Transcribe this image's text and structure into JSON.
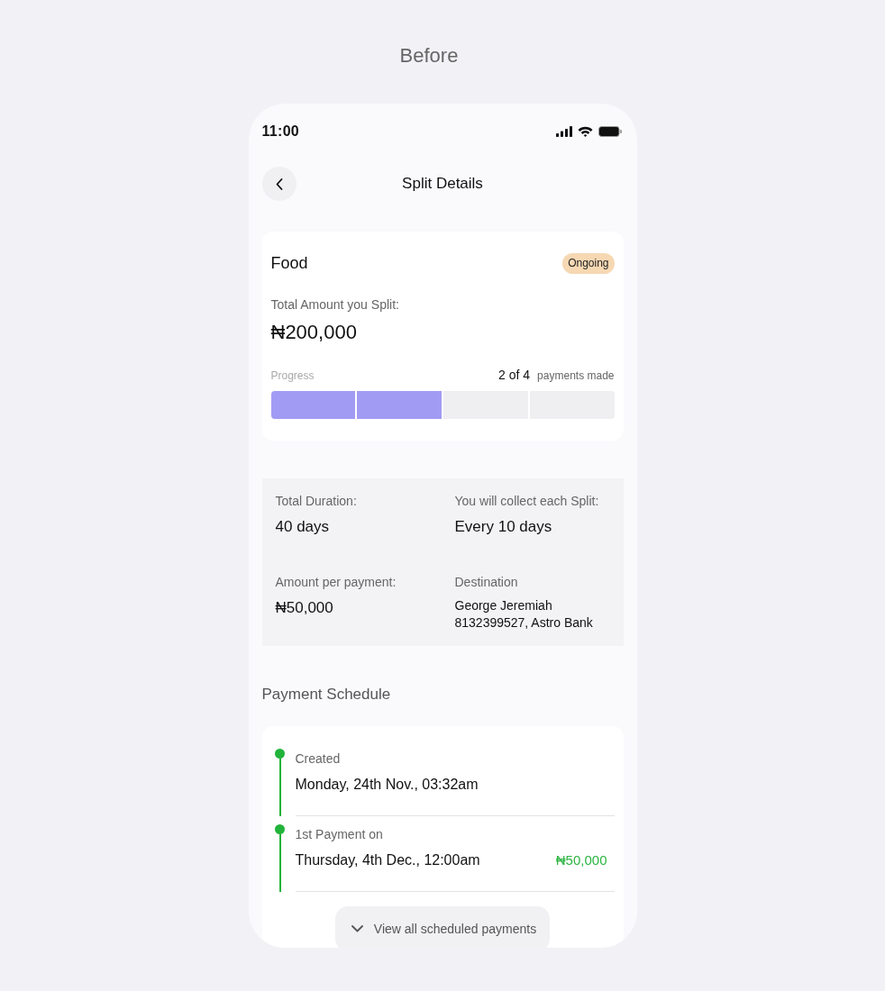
{
  "page_title": "Before",
  "status_bar": {
    "time": "11:00"
  },
  "header": {
    "title": "Split Details"
  },
  "summary": {
    "name": "Food",
    "status": "Ongoing",
    "amount_label": "Total Amount you Split:",
    "amount": "₦200,000",
    "progress": {
      "label": "Progress",
      "count": "2 of 4",
      "count_suffix": "payments made",
      "segments": [
        {
          "filled": true
        },
        {
          "filled": true
        },
        {
          "filled": false
        },
        {
          "filled": false
        }
      ]
    }
  },
  "details": [
    {
      "kind": "stat",
      "label": "Total Duration:",
      "value": "40 days"
    },
    {
      "kind": "stat",
      "label": "You will collect each Split:",
      "value": "Every 10 days"
    },
    {
      "kind": "stat",
      "label": "Amount per payment:",
      "value": "₦50,000"
    },
    {
      "kind": "account",
      "label": "Destination",
      "value": "George Jeremiah",
      "subvalue": "8132399527, Astro Bank"
    }
  ],
  "schedule": {
    "title": "Payment Schedule",
    "events": [
      {
        "label": "Created",
        "date": "Monday, 24th Nov., 03:32am"
      },
      {
        "label": "1st Payment on",
        "date": "Thursday, 4th Dec., 12:00am",
        "amount": "₦50,000"
      }
    ],
    "more_button": "View all scheduled payments"
  }
}
